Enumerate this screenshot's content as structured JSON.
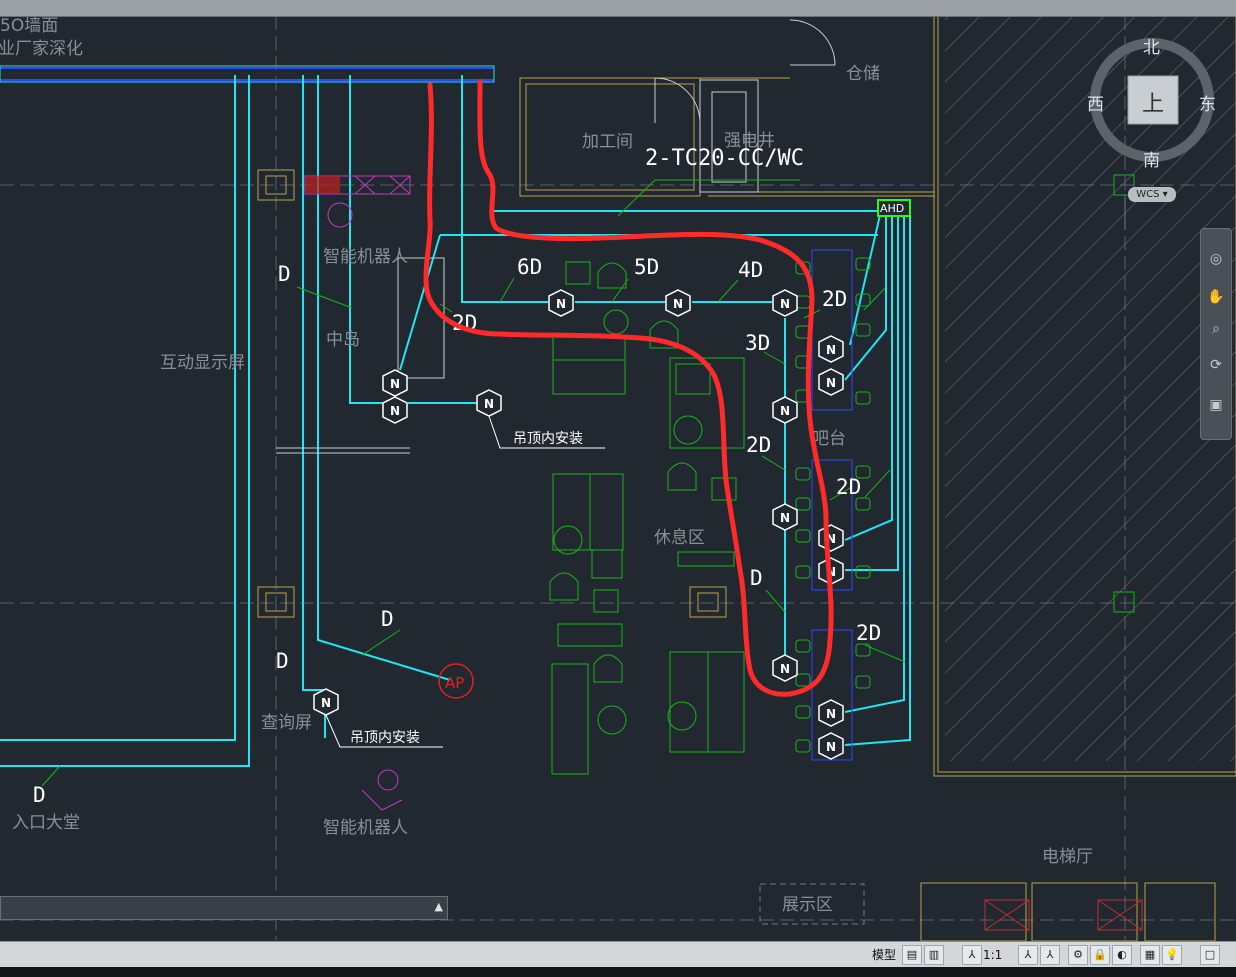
{
  "drawing": {
    "corner_labels": [
      "5O墙面",
      "业厂家深化"
    ],
    "rooms": {
      "storage": "仓储",
      "processing": "加工间",
      "electric": "强电井",
      "robot_top": "智能机器人",
      "robot_bottom": "智能机器人",
      "island": "中岛",
      "display_screen": "互动显示屏",
      "lounge": "休息区",
      "counter": "吧台",
      "query_screen": "查询屏",
      "entrance": "入口大堂",
      "elevator_hall": "电梯厅",
      "showroom": "展示区"
    },
    "pipe_label": "2-TC20-CC/WC",
    "ahd_label": "AHD",
    "ap_label": "AP",
    "ceiling_install_1": "吊顶内安装",
    "ceiling_install_2": "吊顶内安装",
    "node_letter": "N",
    "cable_labels": {
      "l6d": "6D",
      "l5d": "5D",
      "l4d": "4D",
      "l3d": "3D",
      "l2d_a": "2D",
      "l2d_b": "2D",
      "l2d_c": "2D",
      "l2d_d": "2D",
      "l2d_e": "2D",
      "ld_a": "D",
      "ld_b": "D",
      "ld_c": "D",
      "ld_d": "D",
      "ld_e": "D"
    }
  },
  "viewcube": {
    "north": "北",
    "south": "南",
    "west": "西",
    "east": "东",
    "face": "上",
    "wcs": "WCS"
  },
  "statusbar": {
    "model": "模型",
    "scale": "1:1"
  },
  "colors": {
    "background": "#212830",
    "cable": "#1fe6f0",
    "green_linework": "#19b319",
    "red_markup": "#ff2a2a",
    "room_label": "#8a8f95"
  }
}
